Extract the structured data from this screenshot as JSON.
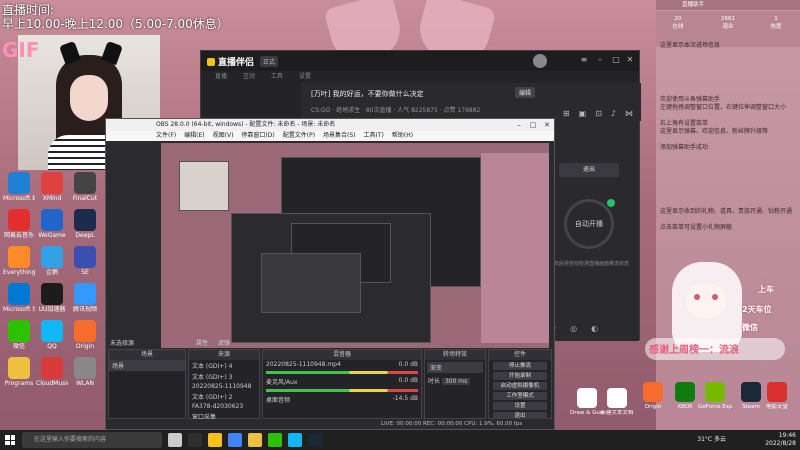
{
  "overlay": {
    "stream_time_label": "直播时间:",
    "stream_time_value": "早上10.00-晚上12.00（5.00-7.00休息）",
    "gif_label": "GIF"
  },
  "desktop_icons_left": [
    {
      "label": "Microsoft Edge",
      "color": "#1f7fd3"
    },
    {
      "label": "XMind",
      "color": "#e04040"
    },
    {
      "label": "FinalCut",
      "color": "#444"
    },
    {
      "label": "网易云音乐",
      "color": "#e23030"
    },
    {
      "label": "WeGame",
      "color": "#2266cc"
    },
    {
      "label": "DeepL",
      "color": "#1b2b4b"
    },
    {
      "label": "Everything",
      "color": "#ff8a2a"
    },
    {
      "label": "企鹅",
      "color": "#33a1e6"
    },
    {
      "label": "SE",
      "color": "#3a4fb0"
    },
    {
      "label": "Microsoft Store",
      "color": "#0078d4"
    },
    {
      "label": "UU加速器",
      "color": "#1c1c1c"
    },
    {
      "label": "腾讯视频",
      "color": "#3399ff"
    },
    {
      "label": "微信",
      "color": "#2dc100"
    },
    {
      "label": "QQ",
      "color": "#12b7f5"
    },
    {
      "label": "Origin",
      "color": "#f56c2d"
    },
    {
      "label": "Programs",
      "color": "#f0c040"
    },
    {
      "label": "CloudMusic",
      "color": "#d93a3a"
    },
    {
      "label": "WLAN",
      "color": "#888"
    }
  ],
  "zhibo": {
    "logo": "直播伴侣",
    "version": "正式",
    "tabs": [
      "直播",
      "互动",
      "工具",
      "设置"
    ],
    "title": "[万叶] 我的好运，不要你做什么决定",
    "title_button": "编辑",
    "meta": "CS:GO · 绝地求生 · 80次直播 · 人气 8225875 · 点赞 176882",
    "exit_button": "退出",
    "ring_label": "自动开播",
    "desc": "开启后将自动检测直播画面推流状态"
  },
  "obs": {
    "title": "OBS 28.0.0 (64-bit, windows) - 配置文件: 未命名 - 场景: 未命名",
    "menu": [
      "文件(F)",
      "编辑(E)",
      "视图(V)",
      "停靠窗口(D)",
      "配置文件(P)",
      "场景集合(S)",
      "工具(T)",
      "帮助(H)"
    ],
    "dock_tabs": [
      "未选择源",
      "属性",
      "滤镜"
    ],
    "scenes_title": "场景",
    "scenes": [
      "场景"
    ],
    "sources_title": "来源",
    "sources": [
      "文本 (GDI+) 4",
      "文本 (GDI+) 3",
      "20220825-1110948",
      "文本 (GDI+) 2",
      "FA378-d2030623",
      "窗口采集"
    ],
    "mixer_title": "混音器",
    "mixer_tracks": [
      {
        "name": "20220825-1110948.mp4",
        "db": "0.0 dB"
      },
      {
        "name": "麦克风/Aux",
        "db": "0.0 dB"
      },
      {
        "name": "桌面音频",
        "db": "-14.5 dB"
      }
    ],
    "transitions_title": "转场特效",
    "transition_value": "渐变",
    "duration_label": "时长",
    "duration_value": "300 ms",
    "controls_title": "控件",
    "controls": [
      "停止推流",
      "开始录制",
      "启动虚拟摄像机",
      "工作室模式",
      "设置",
      "退出"
    ],
    "status": "LIVE: 00:00:00   REC: 00:00:00   CPU: 1.9%, 60.00 fps"
  },
  "chat_panel": {
    "header": "直播助手",
    "stats": [
      {
        "label": "在线",
        "value": "20"
      },
      {
        "label": "观众",
        "value": "2661"
      },
      {
        "label": "热度",
        "value": "1"
      }
    ],
    "messages": [
      "这里显示本次进场信息",
      "欢迎使用斗鱼弹幕助手",
      "左键拖拽调整窗口位置，右键拉伸调整窗口大小",
      "右上角有设置菜单",
      "这里显示弹幕、欢迎信息、粉丝牌升级等",
      "添加弹幕助手成功",
      "这里显示收到的礼物、道具、贵族开通、钻粉开通",
      "点击菜单可设置小礼物屏蔽"
    ],
    "gift_top": "上车",
    "gift_mid": "2天车位",
    "gift_bot": "微信",
    "banner": "感谢上周榜一：流浪"
  },
  "desktop_icons_right": [
    {
      "label": "Steam",
      "color": "#1b2838"
    },
    {
      "label": "电影天堂",
      "color": "#d9302f"
    },
    {
      "label": "GeForce Experience",
      "color": "#76b900"
    },
    {
      "label": "XBOX",
      "color": "#107c10"
    },
    {
      "label": "Origin",
      "color": "#f56c2d"
    },
    {
      "label": "新建文本文档",
      "color": "#ffffff"
    },
    {
      "label": "Draw & Guess",
      "color": "#ffffff"
    }
  ],
  "taskbar": {
    "search_placeholder": "在这里输入你要搜索的内容",
    "weather": "31°C 多云",
    "time": "19:46",
    "date": "2022/8/28",
    "apps": [
      {
        "name": "task-view",
        "color": "#cccccc"
      },
      {
        "name": "obs",
        "color": "#302e31"
      },
      {
        "name": "zhibo",
        "color": "#f4c21b"
      },
      {
        "name": "chrome",
        "color": "#4285f4"
      },
      {
        "name": "explorer",
        "color": "#f0c040"
      },
      {
        "name": "wechat",
        "color": "#2dc100"
      },
      {
        "name": "qq",
        "color": "#12b7f5"
      },
      {
        "name": "steam",
        "color": "#1b2838"
      }
    ]
  }
}
